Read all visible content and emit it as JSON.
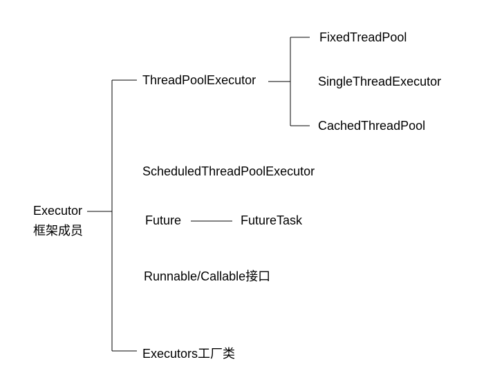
{
  "root": {
    "line1": "Executor",
    "line2": "框架成员"
  },
  "level1": {
    "threadPoolExecutor": "ThreadPoolExecutor",
    "scheduledThreadPoolExecutor": "ScheduledThreadPoolExecutor",
    "future": "Future",
    "futureTask": "FutureTask",
    "runnableCallable": "Runnable/Callable接口",
    "executorsFactory": "Executors工厂类"
  },
  "level2": {
    "fixedTreadPool": "FixedTreadPool",
    "singleThreadExecutor": "SingleThreadExecutor",
    "cachedThreadPool": "CachedThreadPool"
  },
  "chart_data": {
    "type": "tree",
    "title": "Executor 框架成员",
    "root": "Executor 框架成员",
    "children": [
      {
        "name": "ThreadPoolExecutor",
        "children": [
          {
            "name": "FixedTreadPool"
          },
          {
            "name": "SingleThreadExecutor"
          },
          {
            "name": "CachedThreadPool"
          }
        ]
      },
      {
        "name": "ScheduledThreadPoolExecutor"
      },
      {
        "name": "Future",
        "children": [
          {
            "name": "FutureTask"
          }
        ]
      },
      {
        "name": "Runnable/Callable接口"
      },
      {
        "name": "Executors工厂类"
      }
    ]
  }
}
